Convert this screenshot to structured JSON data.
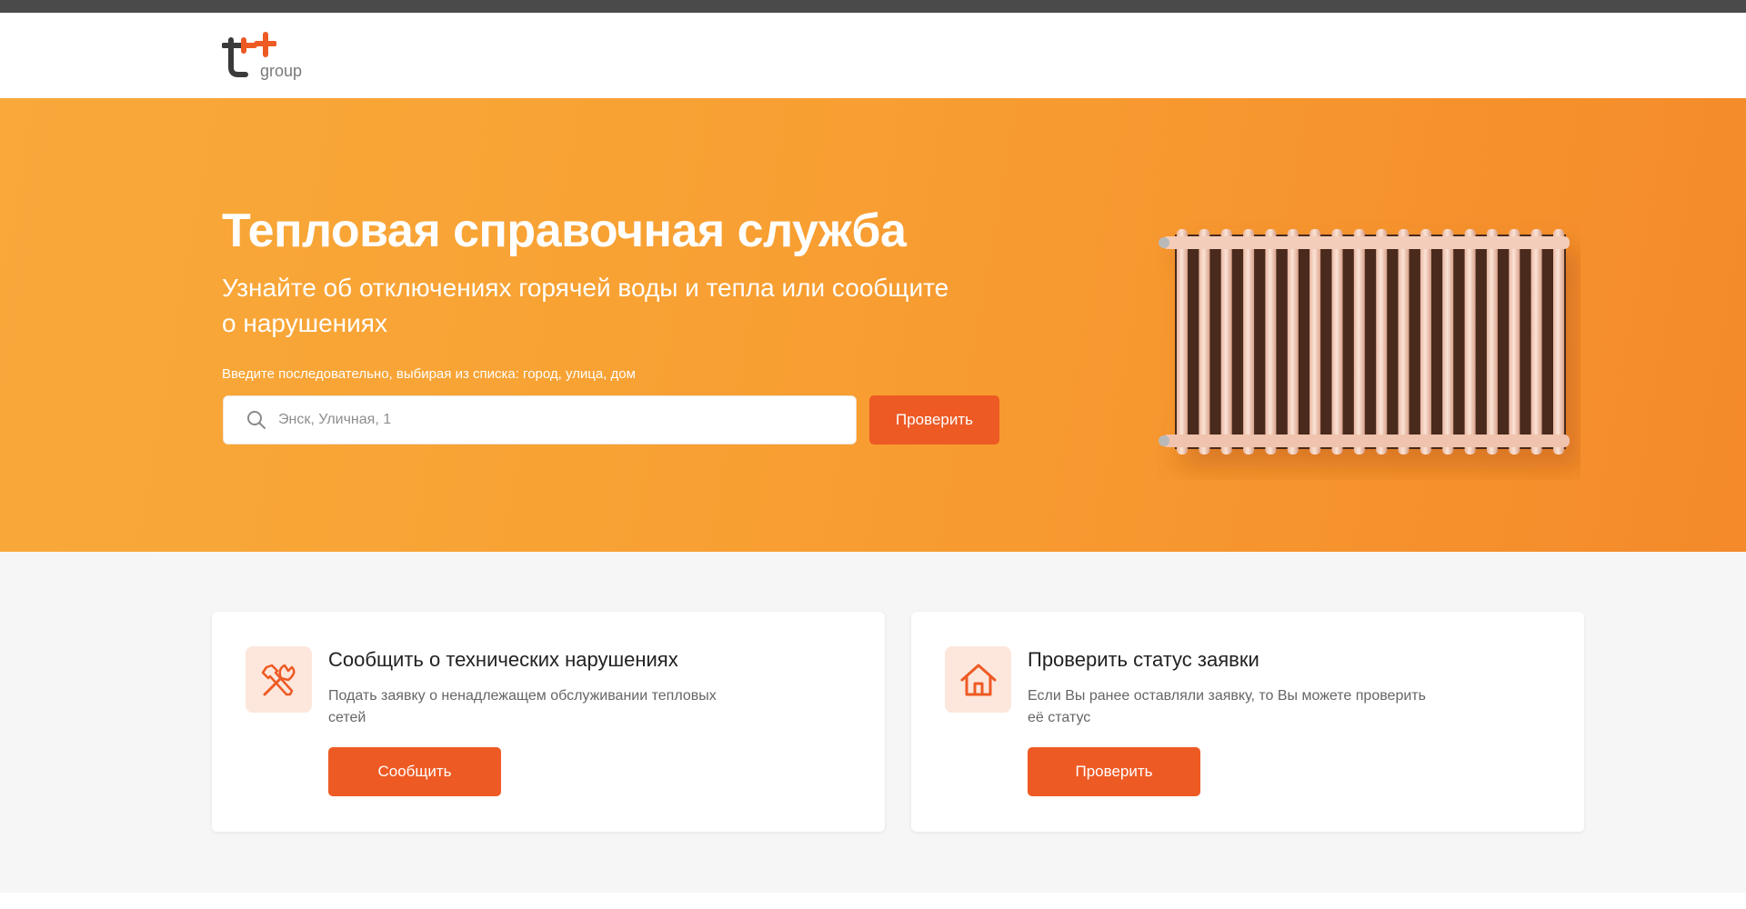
{
  "header": {
    "logo_text": "group"
  },
  "hero": {
    "title": "Тепловая справочная служба",
    "subtitle": "Узнайте об отключениях горячей воды и тепла или сообщите о нарушениях",
    "hint": "Введите последовательно, выбирая из списка: город, улица, дом",
    "search": {
      "placeholder": "Энск, Уличная, 1",
      "value": ""
    },
    "check_label": "Проверить"
  },
  "cards": [
    {
      "icon": "tools-icon",
      "title": "Сообщить о технических нарушениях",
      "text": "Подать заявку о ненадлежащем обслуживании тепловых сетей",
      "button_label": "Сообщить"
    },
    {
      "icon": "house-icon",
      "title": "Проверить статус заявки",
      "text": "Если Вы ранее оставляли заявку, то Вы можете проверить её статус",
      "button_label": "Проверить"
    }
  ],
  "colors": {
    "accent": "#ee5a24",
    "hero_start": "#f8a93a",
    "hero_end": "#f48a2a",
    "icon_bg": "#fde7dc"
  }
}
